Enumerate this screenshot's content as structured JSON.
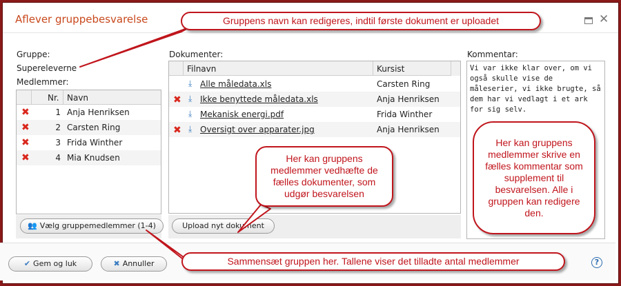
{
  "window": {
    "title": "Aflever gruppebesvarelse"
  },
  "group": {
    "label": "Gruppe:",
    "name": "Supereleverne"
  },
  "members": {
    "label": "Medlemmer:",
    "columns": {
      "nr": "Nr.",
      "name": "Navn"
    },
    "rows": [
      {
        "nr": "1",
        "name": "Anja Henriksen"
      },
      {
        "nr": "2",
        "name": "Carsten Ring"
      },
      {
        "nr": "3",
        "name": "Frida Winther"
      },
      {
        "nr": "4",
        "name": "Mia Knudsen"
      }
    ],
    "select_button": "Vælg gruppemedlemmer (1-4)"
  },
  "documents": {
    "label": "Dokumenter:",
    "columns": {
      "file": "Filnavn",
      "student": "Kursist"
    },
    "rows": [
      {
        "file": "Alle måledata.xls",
        "student": "Carsten Ring",
        "removable": false
      },
      {
        "file": "Ikke benyttede måledata.xls",
        "student": "Anja Henriksen",
        "removable": true
      },
      {
        "file": "Mekanisk energi.pdf",
        "student": "Frida Winther",
        "removable": false
      },
      {
        "file": "Oversigt over apparater.jpg",
        "student": "Anja Henriksen",
        "removable": true
      }
    ],
    "upload_button": "Upload nyt dokument"
  },
  "comment": {
    "label": "Kommentar:",
    "text": "Vi var ikke klar over, om vi også skulle vise de måleserier, vi ikke brugte, så dem har vi vedlagt i et ark for sig selv."
  },
  "footer": {
    "save_button": "Gem og luk",
    "cancel_button": "Annuller",
    "help": "?"
  },
  "callouts": {
    "top": "Gruppens navn kan redigeres, indtil første dokument er uploadet",
    "documents": "Her kan gruppens medlemmer vedhæfte de fælles dokumenter, som udgør besvarelsen",
    "comment": "Her kan gruppens medlemmer skrive en fælles kommentar som supplement til besvarelsen. Alle i gruppen kan redigere den.",
    "bottom": "Sammensæt gruppen her. Tallene viser det tilladte antal medlemmer"
  },
  "colors": {
    "title": "#c8481c",
    "callout": "#c0151c",
    "remove_icon": "#d9261c",
    "download_icon": "#3a7cc0",
    "frame": "#8a1a1a"
  }
}
